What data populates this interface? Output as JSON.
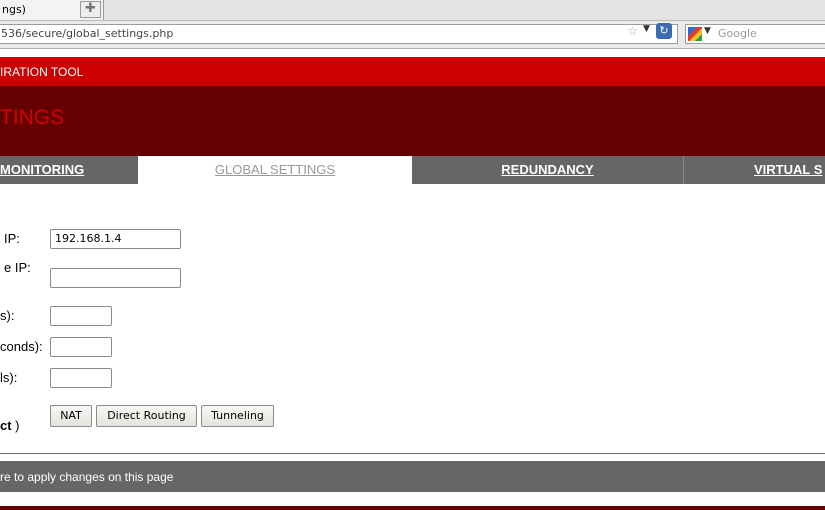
{
  "browser": {
    "tab_title": "ngs)",
    "new_tab_label": "✚",
    "url": "536/secure/global_settings.php",
    "search_placeholder": "Google"
  },
  "header": {
    "tool_name": "IRATION TOOL",
    "page_title": "TINGS"
  },
  "nav": {
    "tabs": [
      {
        "label": "MONITORING"
      },
      {
        "label": "GLOBAL SETTINGS",
        "active": true
      },
      {
        "label": "REDUNDANCY"
      },
      {
        "label": "VIRTUAL S"
      }
    ]
  },
  "form": {
    "fields": [
      {
        "label": "IP:",
        "value": "192.168.1.4"
      },
      {
        "label": "e IP:",
        "value": ""
      },
      {
        "label": "s):",
        "value": ""
      },
      {
        "label": "conds):",
        "value": ""
      },
      {
        "label": "ls):",
        "value": ""
      }
    ],
    "routing_label_bold": "ct",
    "routing_label_suffix": " )",
    "routing_buttons": [
      "NAT",
      "Direct Routing",
      "Tunneling"
    ]
  },
  "footer": {
    "apply_text": "re to apply changes on this page"
  },
  "colors": {
    "red": "#cc0000",
    "dark_red": "#650000",
    "gray": "#666666"
  }
}
